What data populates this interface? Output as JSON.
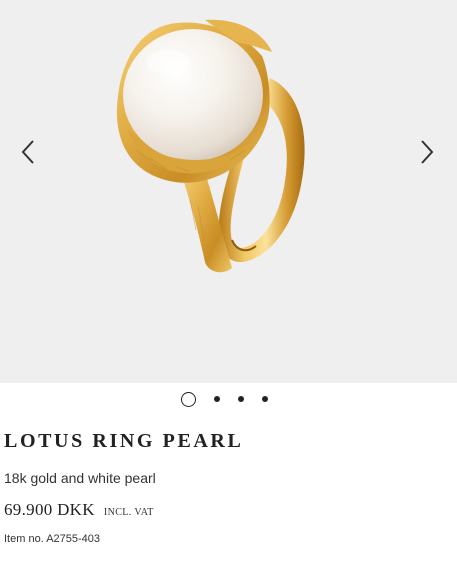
{
  "gallery": {
    "image_alt": "Lotus ring with white pearl in 18k gold",
    "prev_icon": "chevron-left-icon",
    "next_icon": "chevron-right-icon",
    "slide_count": 4,
    "active_slide": 1
  },
  "product": {
    "title": "LOTUS RING PEARL",
    "subtitle": "18k gold and white pearl",
    "price": "69.900 DKK",
    "vat_label": "INCL. VAT",
    "item_number": "Item no. A2755-403"
  },
  "colors": {
    "background": "#efefef",
    "gold": "#d9a43a",
    "pearl": "#f5f1ec",
    "text": "#222222"
  }
}
